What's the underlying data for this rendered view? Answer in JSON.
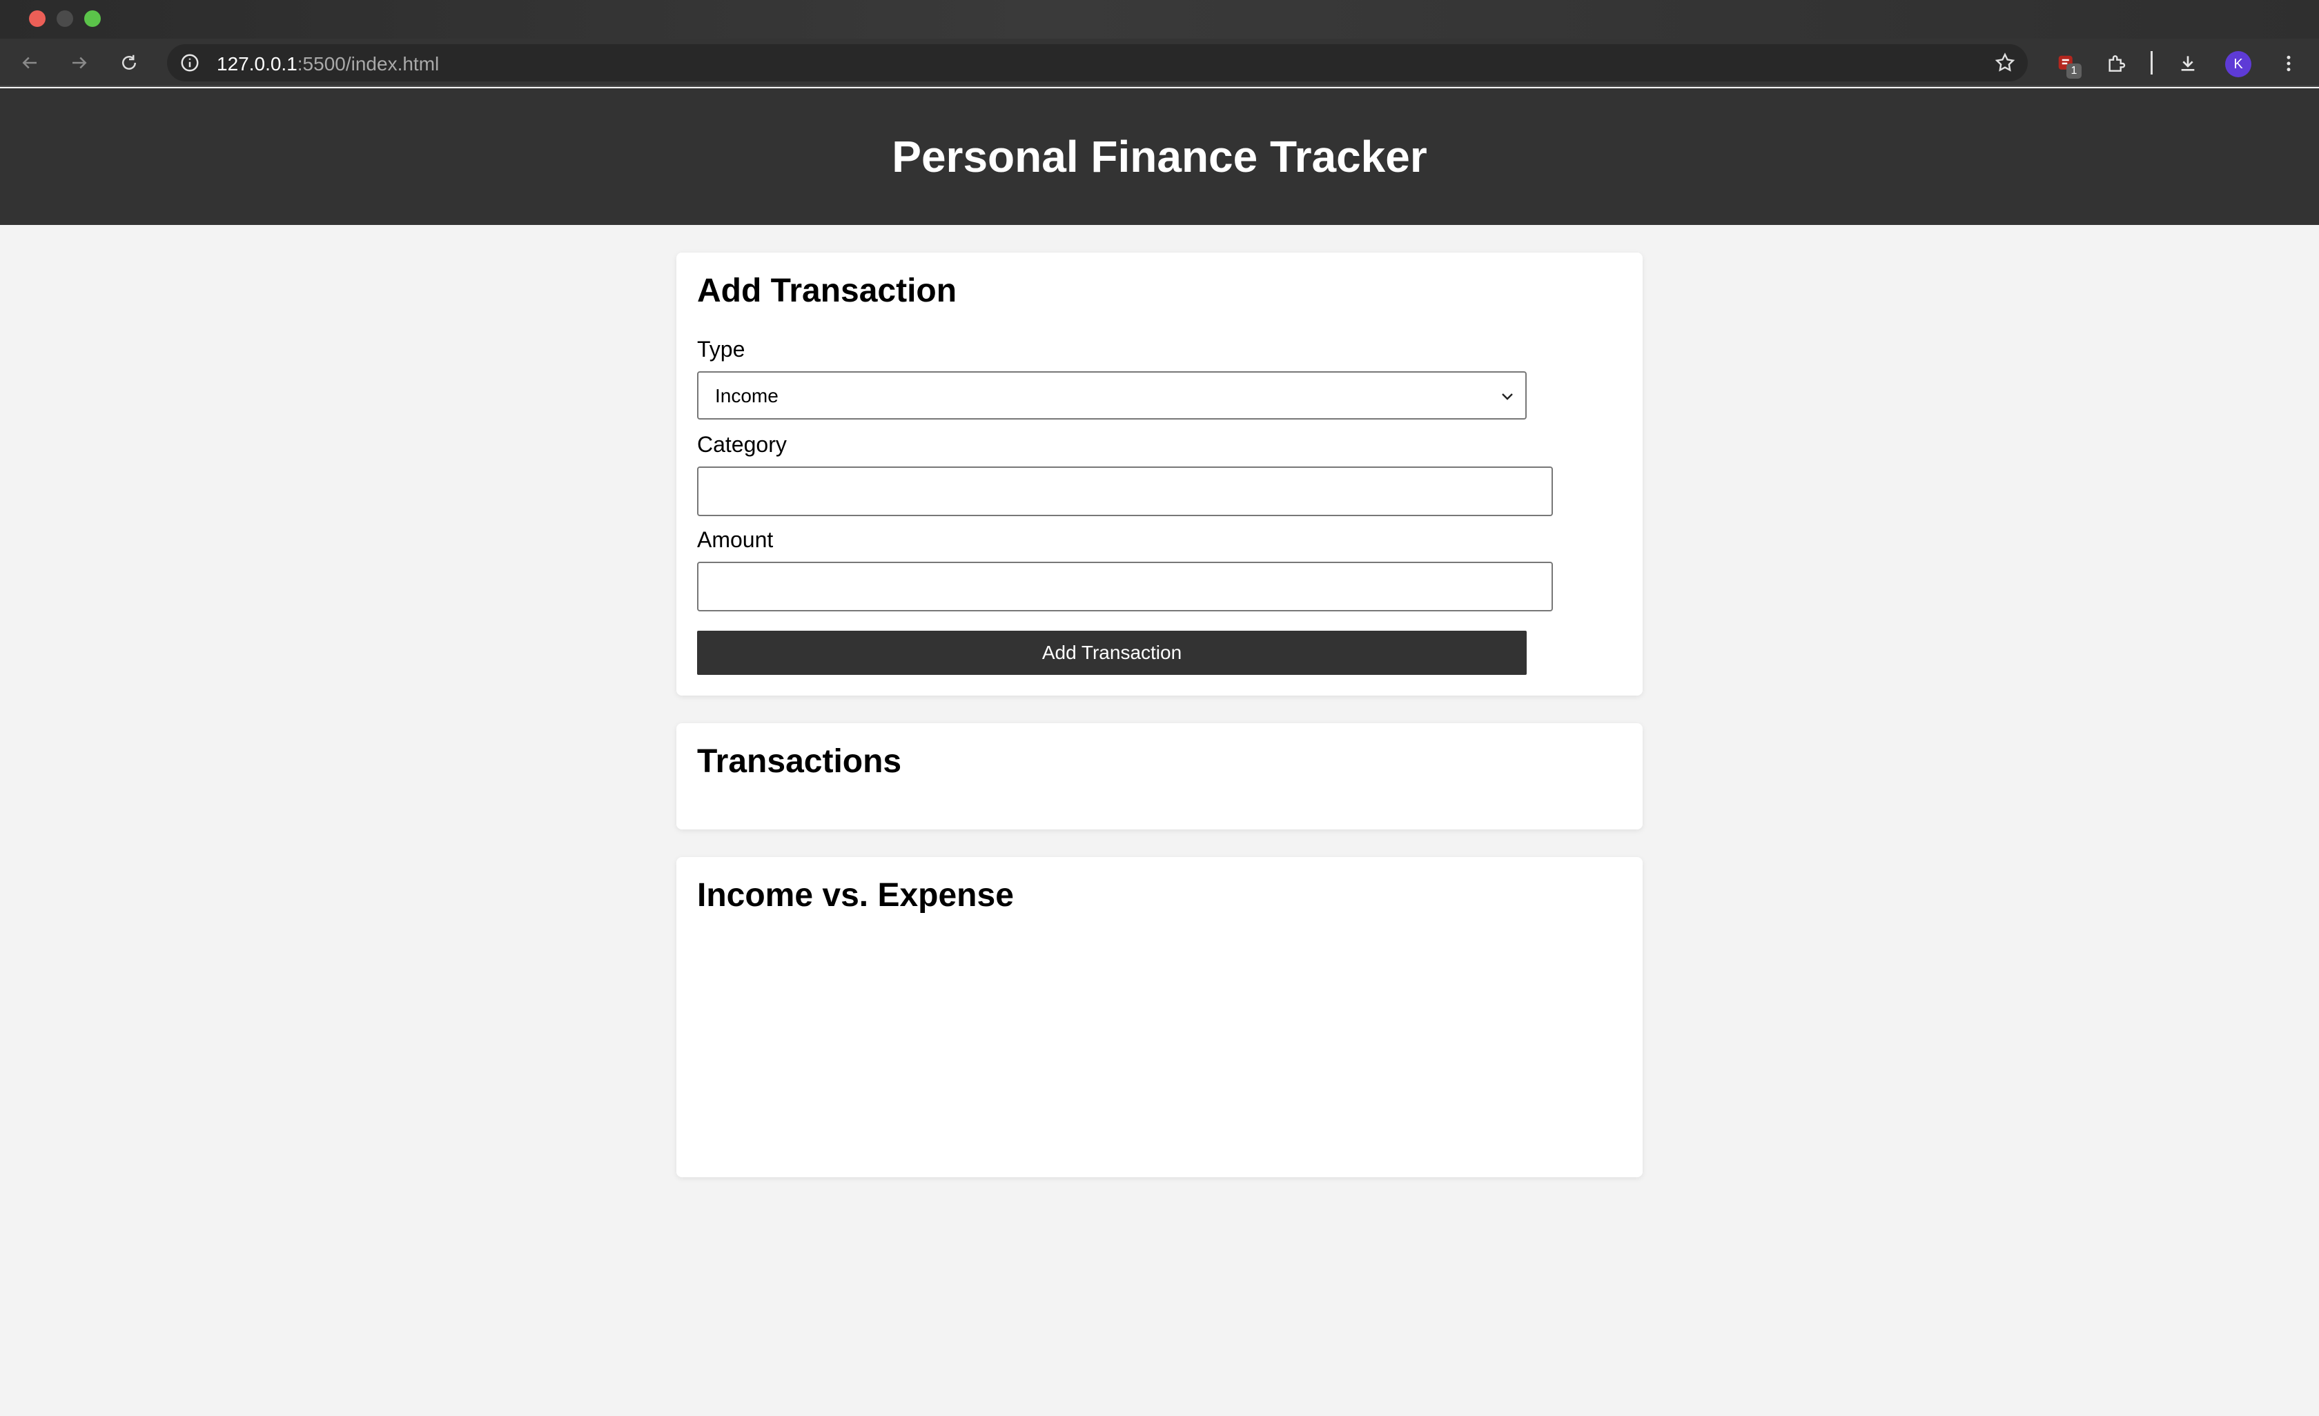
{
  "browser": {
    "url_host": "127.0.0.1",
    "url_path": ":5500/index.html",
    "extension_badge": "1",
    "profile_initial": "K"
  },
  "header": {
    "title": "Personal Finance Tracker"
  },
  "add_transaction": {
    "heading": "Add Transaction",
    "type_label": "Type",
    "type_value": "Income",
    "category_label": "Category",
    "category_value": "",
    "amount_label": "Amount",
    "amount_value": "",
    "submit_label": "Add Transaction"
  },
  "transactions": {
    "heading": "Transactions",
    "items": []
  },
  "chart": {
    "heading": "Income vs. Expense"
  },
  "colors": {
    "header_bg": "#333333",
    "page_bg": "#f3f3f3",
    "button_bg": "#333333",
    "card_bg": "#ffffff"
  }
}
